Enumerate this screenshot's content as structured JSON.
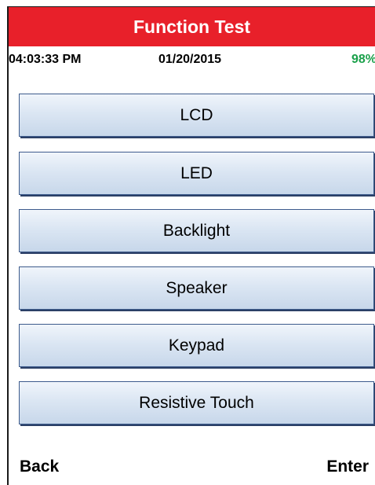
{
  "header": {
    "title": "Function Test"
  },
  "status": {
    "time": "04:03:33 PM",
    "date": "01/20/2015",
    "battery": "98%"
  },
  "menu": {
    "items": [
      {
        "label": "LCD"
      },
      {
        "label": "LED"
      },
      {
        "label": "Backlight"
      },
      {
        "label": "Speaker"
      },
      {
        "label": "Keypad"
      },
      {
        "label": "Resistive Touch"
      }
    ]
  },
  "softkeys": {
    "left_label": "Back",
    "right_label": "Enter"
  },
  "colors": {
    "title_bar": "#e8202a",
    "battery_text": "#1aa04a",
    "button_border": "#3d5b8c",
    "button_fill": "#dbe6f3"
  }
}
